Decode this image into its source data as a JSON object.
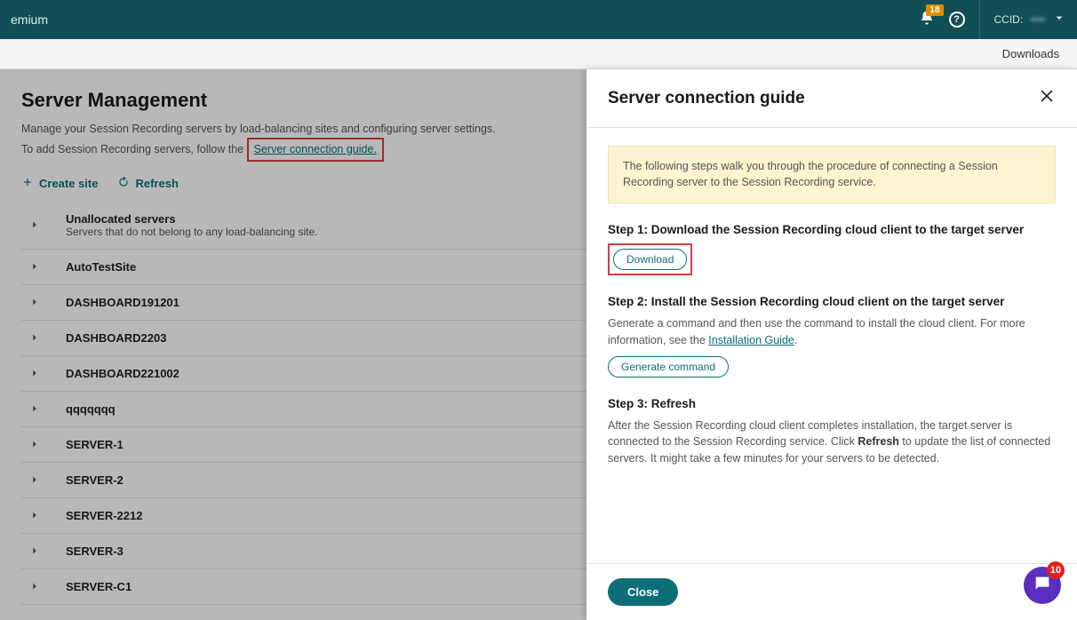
{
  "topbar": {
    "brand_fragment": "emium",
    "bell_badge": "18",
    "ccid_label": "CCID:",
    "ccid_value": "••••"
  },
  "subbar": {
    "downloads": "Downloads"
  },
  "page": {
    "title": "Server Management",
    "desc1": "Manage your Session Recording servers by load-balancing sites and configuring server settings.",
    "desc2_prefix": "To add Session Recording servers, follow the",
    "desc2_link": "Server connection guide.",
    "create_site": "Create site",
    "refresh": "Refresh",
    "sites": [
      {
        "label": "Unallocated servers",
        "sub": "Servers that do not belong to any load-balancing site."
      },
      {
        "label": "AutoTestSite",
        "sub": ""
      },
      {
        "label": "DASHBOARD191201",
        "sub": ""
      },
      {
        "label": "DASHBOARD2203",
        "sub": ""
      },
      {
        "label": "DASHBOARD221002",
        "sub": ""
      },
      {
        "label": "qqqqqqq",
        "sub": ""
      },
      {
        "label": "SERVER-1",
        "sub": ""
      },
      {
        "label": "SERVER-2",
        "sub": ""
      },
      {
        "label": "SERVER-2212",
        "sub": ""
      },
      {
        "label": "SERVER-3",
        "sub": ""
      },
      {
        "label": "SERVER-C1",
        "sub": ""
      }
    ]
  },
  "panel": {
    "title": "Server connection guide",
    "info": "The following steps walk you through the procedure of connecting a Session Recording server to the Session Recording service.",
    "step1_title": "Step 1: Download the Session Recording cloud client to the target server",
    "download": "Download",
    "step2_title": "Step 2: Install the Session Recording cloud client on the target server",
    "step2_desc_prefix": "Generate a command and then use the command to install the cloud client. For more information, see the ",
    "step2_link": "Installation Guide",
    "step2_desc_suffix": ".",
    "generate_command": "Generate command",
    "step3_title": "Step 3: Refresh",
    "step3_desc_prefix": "After the Session Recording cloud client completes installation, the target server is connected to the Session Recording service. Click ",
    "step3_bold": "Refresh",
    "step3_desc_suffix": " to update the list of connected servers. It might take a few minutes for your servers to be detected.",
    "close": "Close"
  },
  "float": {
    "badge": "10"
  }
}
